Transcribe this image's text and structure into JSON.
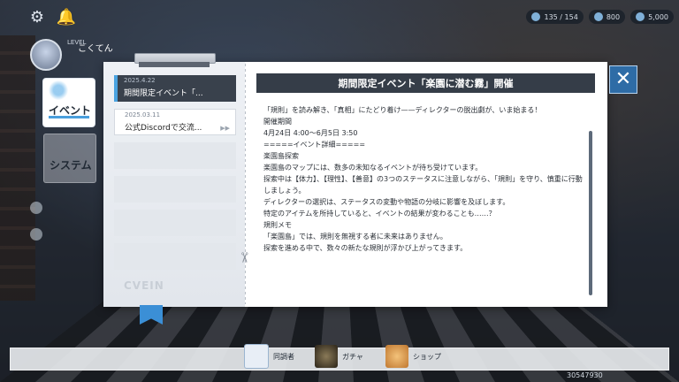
{
  "hud": {
    "settings_icon": "gear-icon",
    "notice_icon": "bell-icon",
    "level_label": "LEVEL",
    "player_name": "こくてん",
    "resources": [
      {
        "icon": "stamina-icon",
        "value": "135 / 154"
      },
      {
        "icon": "crystal-icon",
        "value": "800"
      },
      {
        "icon": "coin-icon",
        "value": "5,000"
      }
    ]
  },
  "categories": [
    {
      "label": "イベント",
      "selected": true
    },
    {
      "label": "システム",
      "selected": false
    }
  ],
  "news": [
    {
      "date": "2025.4.22",
      "title": "期間限定イベント「...",
      "selected": true
    },
    {
      "date": "2025.03.11",
      "title": "公式Discordで交流...",
      "selected": false
    }
  ],
  "logo_text": "CVEIN",
  "article": {
    "heading": "期間限定イベント「楽園に潜む霧」開催",
    "lines": [
      "「規則」を読み解き、「真相」にたどり着け——ディレクターの脱出劇が、いま始まる！",
      "",
      "開催期間",
      "4月24日 4:00～6月5日 3:50",
      "",
      "=====イベント詳細=====",
      "楽園島探索",
      "楽園島のマップには、数多の未知なるイベントが待ち受けています。",
      "探索中は【体力】、【理性】、【善意】の3つのステータスに注意しながら、「規則」を守り、慎重に行動",
      "しましょう。",
      "ディレクターの選択は、ステータスの変動や物語の分岐に影響を及ぼします。",
      "特定のアイテムを所持していると、イベントの結果が変わることも……？",
      "",
      "規則メモ",
      "「楽園島」では、規則を無視する者に未来はありません。",
      "探索を進める中で、数々の新たな規則が浮かび上がってきます。"
    ]
  },
  "close_icon": "close-icon",
  "bottom_nav": [
    {
      "label": "同調者",
      "icon": "partner-icon"
    },
    {
      "label": "ガチャ",
      "icon": "gacha-icon"
    },
    {
      "label": "ショップ",
      "icon": "shop-icon"
    }
  ],
  "uid": "30547930"
}
